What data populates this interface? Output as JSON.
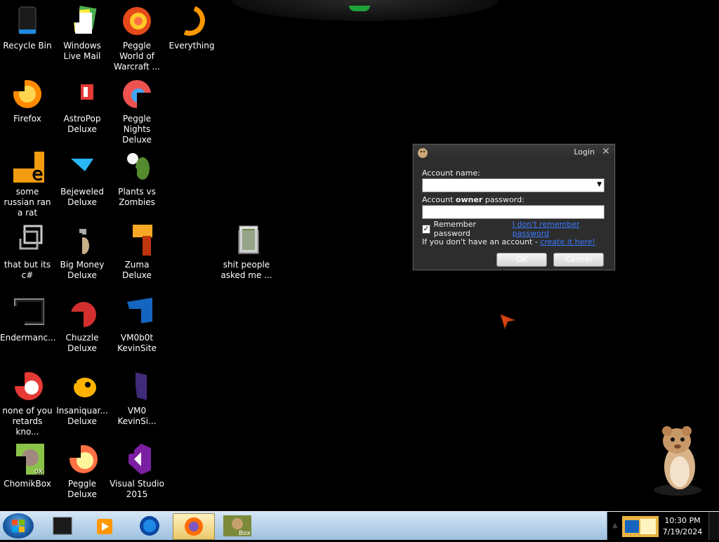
{
  "desktop": {
    "icons": [
      {
        "label": "Recycle Bin",
        "icon": "recycle-bin-icon"
      },
      {
        "label": "Windows Live Mail",
        "icon": "windows-live-mail-icon"
      },
      {
        "label": "Peggle World of Warcraft ...",
        "icon": "peggle-wow-icon"
      },
      {
        "label": "Everything",
        "icon": "everything-icon"
      },
      {
        "label": "Firefox",
        "icon": "firefox-icon"
      },
      {
        "label": "AstroPop Deluxe",
        "icon": "astropop-icon"
      },
      {
        "label": "Peggle Nights Deluxe",
        "icon": "peggle-nights-icon"
      },
      {
        "label": "some russian ran a rat",
        "icon": "app-icon"
      },
      {
        "label": "Bejeweled Deluxe",
        "icon": "bejeweled-icon"
      },
      {
        "label": "Plants vs Zombies",
        "icon": "plants-vs-zombies-icon"
      },
      {
        "label": "that but its c#",
        "icon": "app-icon"
      },
      {
        "label": "Big Money Deluxe",
        "icon": "big-money-icon"
      },
      {
        "label": "Zuma Deluxe",
        "icon": "zuma-icon"
      },
      {
        "label": "shit people asked me ...",
        "icon": "folder-icon"
      },
      {
        "label": "Endermanc...",
        "icon": "app-icon"
      },
      {
        "label": "Chuzzle Deluxe",
        "icon": "chuzzle-icon"
      },
      {
        "label": "VM0b0t KevinSite",
        "icon": "app-icon"
      },
      {
        "label": "none of you retards kno...",
        "icon": "app-icon"
      },
      {
        "label": "Insaniquar... Deluxe",
        "icon": "insaniquarium-icon"
      },
      {
        "label": "VM0 KevinSi...",
        "icon": "app-icon"
      },
      {
        "label": "ChomikBox",
        "icon": "chomikbox-icon"
      },
      {
        "label": "Peggle Deluxe",
        "icon": "peggle-icon"
      },
      {
        "label": "Visual Studio 2015",
        "icon": "visual-studio-icon"
      }
    ]
  },
  "login_dialog": {
    "title": "Login",
    "account_name_label": "Account name:",
    "password_label_pre": "Account ",
    "password_label_bold": "owner",
    "password_label_post": " password:",
    "remember_label": "Remember password",
    "remember_checked": "✓",
    "forgot_link": "I don't remember password",
    "no_account_text": "If you don't have an account - ",
    "create_link": "create it here!",
    "ok_label": "OK",
    "cancel_label": "Cancel",
    "close_glyph": "✕"
  },
  "taskbar": {
    "time": "10:30 PM",
    "date": "7/19/2024"
  }
}
